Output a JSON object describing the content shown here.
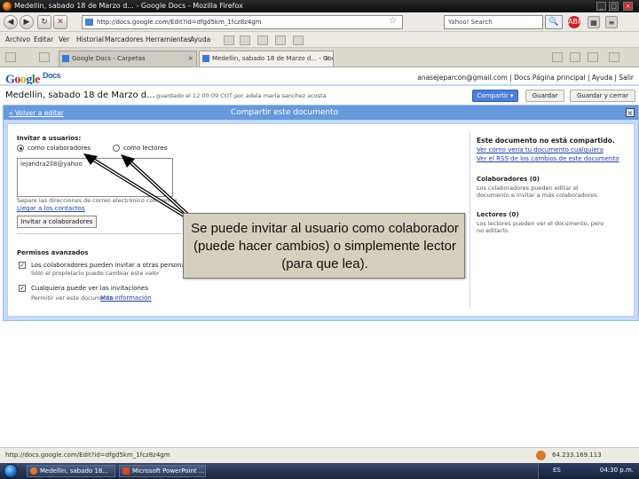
{
  "window": {
    "title": "Medellin, sabado 18 de Marzo d... - Google Docs - Mozilla Firefox",
    "controls": [
      "_",
      "□",
      "×"
    ]
  },
  "nav": {
    "back_icon": "◀",
    "forward_icon": "▶",
    "url": "http://docs.google.com/Edit?id=dfgd5km_1fcz8z4gm",
    "search_placeholder": "Yahoo! Search",
    "search_go": "🔍"
  },
  "menu": {
    "items": [
      "Archivo",
      "Editar",
      "Ver",
      "Historial",
      "Marcadores",
      "Herramientas",
      "Ayuda"
    ]
  },
  "tabs": [
    {
      "label": "Google Docs - Carpetas",
      "active": false
    },
    {
      "label": "Medellin, sabado 18 de Marzo d... - Goo...",
      "active": true
    }
  ],
  "gdocs": {
    "logo_google": "Google",
    "logo_docs": "Docs",
    "user_line": "anasejeparcon@gmail.com | Docs Página principal | Ayuda | Salir",
    "doc_title": "Medellin, sabado 18 de Marzo d...",
    "saved_note": "guardado el 12:00:09 COT por adela maria sanchez acosta",
    "share_button": "Compartir ▾",
    "save_button": "Guardar",
    "save_close_button": "Guardar y cerrar"
  },
  "share": {
    "back_link": "« Volver a editar",
    "title": "Compartir este documento",
    "close": "×",
    "invite_heading": "Invitar a usuarios:",
    "option_collaborators": "como colaboradores",
    "option_readers": "como lectores",
    "textarea_value": "lejandra2ll8@yahoo",
    "separate_hint": "Separe las direcciones de correo electrónico con comas",
    "use_contacts": "Llegar a los contactos",
    "invite_button": "Invitar a colaboradores",
    "advanced_heading": "Permisos avanzados",
    "adv_option1": "Los colaboradores pueden invitar a otras personas",
    "adv_option1_sub": "Sólo el propietario puede cambiar este valor",
    "adv_option2": "Cualquiera puede ver las invitaciones",
    "adv_option2_sub": "Permitir ver este documento",
    "adv_option2_link": "Más información",
    "not_shared_heading": "Este documento no está compartido.",
    "view_as_link": "Ver como vería tu documento cualquiera",
    "rss_link": "Ver el RSS de los cambios de este documento",
    "collaborators_heading": "Colaboradores (0)",
    "collaborators_desc": "Los colaboradores pueden editar el documento e invitar a más colaboradores.",
    "readers_heading": "Lectores (0)",
    "readers_desc": "Los lectores pueden ver el documento, pero no editarlo."
  },
  "callout": {
    "text": "Se puede invitar al usuario como colaborador (puede hacer cambios) o simplemente lector (para que lea)."
  },
  "status": {
    "url": "http://docs.google.com/Edit?id=dfgd5km_1fcz8z4gm",
    "ip": "64.233.169.113"
  },
  "taskbar": {
    "tasks": [
      "Medellin, sabado 18...",
      "Microsoft PowerPoint ..."
    ],
    "lang": "ES",
    "clock": "04:30 p.m."
  },
  "colors": {
    "share_panel": "#c3d9ff",
    "share_header": "#6699dd",
    "primary_button": "#4d7fd7",
    "callout_bg": "#d4cfbf"
  }
}
